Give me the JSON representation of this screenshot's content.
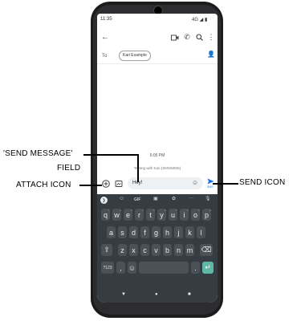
{
  "status_bar": {
    "time": "11:35",
    "signal": "4G ◢ ▮"
  },
  "app_bar": {
    "back_icon": "arrow-left",
    "video_icon": "video-call",
    "call_icon": "phone",
    "search_icon": "search",
    "more_icon": "more-vert"
  },
  "recipient": {
    "to_label": "To",
    "chip": "Kari Example",
    "add_icon": "add-person"
  },
  "conversation": {
    "time": "6:05 PM",
    "info": "Texting with Kari (SMS/MMS)"
  },
  "compose": {
    "text": "Hey!",
    "send_sub": "SMS"
  },
  "keyboard": {
    "toolbar": [
      "❯",
      "☺",
      "GIF",
      "▣",
      "✿",
      "···",
      "🎙"
    ],
    "row1": [
      "q",
      "w",
      "e",
      "r",
      "t",
      "y",
      "u",
      "i",
      "o",
      "p"
    ],
    "row1_nums": [
      "1",
      "2",
      "3",
      "4",
      "5",
      "6",
      "7",
      "8",
      "9",
      "0"
    ],
    "row2": [
      "a",
      "s",
      "d",
      "f",
      "g",
      "h",
      "j",
      "k",
      "l"
    ],
    "row3": [
      "z",
      "x",
      "c",
      "v",
      "b",
      "n",
      "m"
    ],
    "shift": "⇧",
    "backspace": "⌫",
    "symbols": "?123",
    "comma": ",",
    "emoji": "☺",
    "period": ".",
    "enter": "↵"
  },
  "nav": {
    "back": "▼",
    "home": "●",
    "recents": "■"
  },
  "callouts": {
    "send_message_field": "'SEND MESSAGE'",
    "send_message_field_2": "FIELD",
    "attach_icon": "ATTACH ICON",
    "send_icon": "SEND ICON"
  },
  "colors": {
    "keyboard_bg": "#353d42",
    "key": "#4a5257",
    "enter": "#5fb7a8",
    "send": "#1a73e8"
  }
}
